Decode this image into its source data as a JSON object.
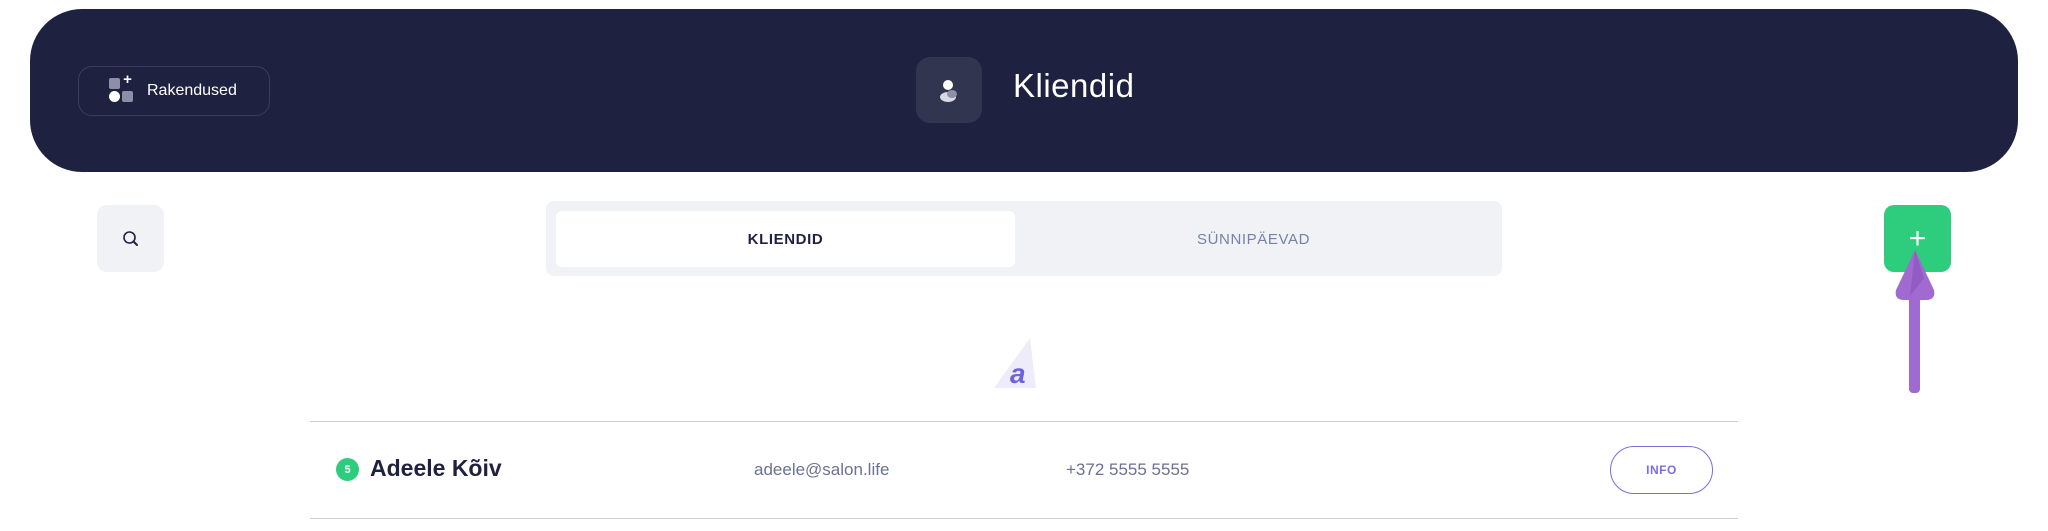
{
  "header": {
    "apps_button_label": "Rakendused",
    "apps_icon": "apps-icon",
    "page_icon": "client-icon",
    "title": "Kliendid"
  },
  "toolbar": {
    "search_icon": "search-icon",
    "add_icon": "plus-icon",
    "add_label": "+"
  },
  "tabs": [
    {
      "label": "KLIENDID",
      "active": true
    },
    {
      "label": "SÜNNIPÄEVAD",
      "active": false
    }
  ],
  "alphabet_marker": {
    "letter": "a"
  },
  "clients": [
    {
      "badge": "5",
      "name": "Adeele Kõiv",
      "email": "adeele@salon.life",
      "phone": "+372 5555 5555",
      "action_label": "INFO"
    }
  ],
  "colors": {
    "header_bg": "#1e2140",
    "accent_green": "#2ecc7d",
    "accent_purple": "#7b6ce0",
    "annotation_arrow": "#a06ad0"
  }
}
